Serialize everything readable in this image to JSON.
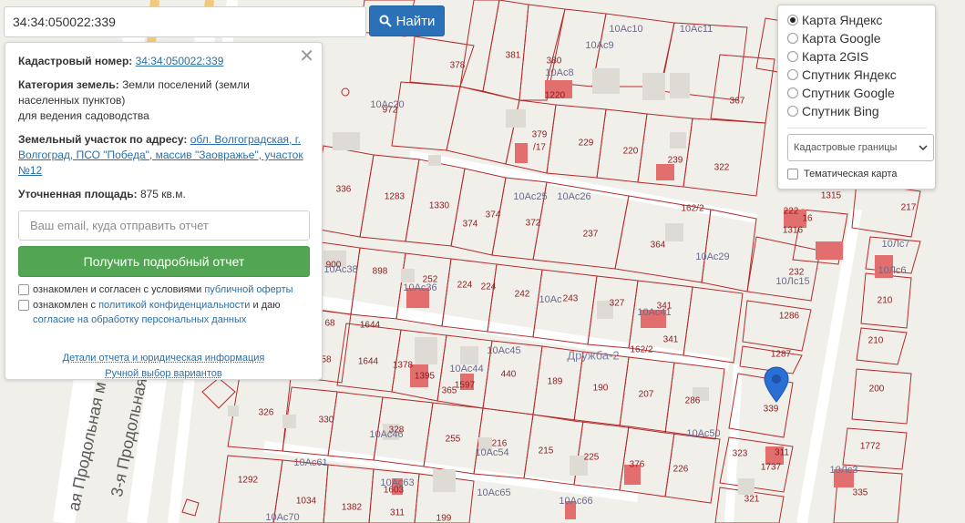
{
  "search": {
    "value": "34:34:050022:339",
    "button_label": "Найти",
    "button_icon": "search-icon"
  },
  "info_card": {
    "cadastral_label": "Кадастровый номер:",
    "cadastral_value": "34:34:050022:339",
    "category_label": "Категория земель:",
    "category_value": "Земли поселений (земли населенных пунктов)",
    "usage_value": "для ведения садоводства",
    "address_label": "Земельный участок по адресу:",
    "address_value": "обл. Волгоградская, г. Волгоград, ПСО \"Победа\", массив \"Заовражье\", участок №12",
    "area_label": "Уточненная площадь:",
    "area_value": "875 кв.м.",
    "email_placeholder": "Ваш email, куда отправить отчет",
    "report_button": "Получить подробный отчет",
    "agree1_text": "ознакомлен и согласен с условиями",
    "agree1_link": "публичной оферты",
    "agree2_text": "ознакомлен с",
    "agree2_link": "политикой конфиденциальности",
    "agree2_and": "и даю",
    "agree2_link2": "согласие на обработку персональных данных",
    "details_link": "Детали отчета и юридическая информация",
    "manual_link": "Ручной выбор вариантов",
    "close_icon": "close-icon"
  },
  "layer_panel": {
    "options": [
      {
        "label": "Карта Яндекс",
        "checked": true
      },
      {
        "label": "Карта Google",
        "checked": false
      },
      {
        "label": "Карта 2GIS",
        "checked": false
      },
      {
        "label": "Спутник Яндекс",
        "checked": false
      },
      {
        "label": "Спутник Google",
        "checked": false
      },
      {
        "label": "Спутник Bing",
        "checked": false
      }
    ],
    "select_value": "Кадастровые границы",
    "thematic_label": "Тематическая карта"
  },
  "map": {
    "street_label_1": "3-я Продольная",
    "street_label_2": "ая Продольная м",
    "drujba_label": "Дружба-2",
    "selected_plot": "339",
    "pin_icon": "map-pin-icon",
    "plot_labels": [
      "378",
      "381",
      "380",
      "10Ac8",
      "10Ac9",
      "10Ac10",
      "10Ac11",
      "1220",
      "972",
      "10Ac20",
      "379",
      "/17",
      "229",
      "220",
      "239",
      "322",
      "367",
      "336",
      "1283",
      "1330",
      "374",
      "374",
      "10Ac25",
      "10Ac26",
      "372",
      "237",
      "364",
      "162/2",
      "10Ac29",
      "900",
      "10Ac38",
      "898",
      "252",
      "10Ac36",
      "224",
      "224",
      "242",
      "10Ac",
      "243",
      "327",
      "341",
      "10Ac41",
      "341",
      "1644",
      "1378",
      "1395",
      "10Ac44",
      "10Ac45",
      "1597",
      "365",
      "440",
      "189",
      "190",
      "207",
      "286",
      "162/2",
      "1644",
      "326",
      "330",
      "328",
      "10Ac46",
      "255",
      "216",
      "10Ac54",
      "215",
      "225",
      "376",
      "10Ac50",
      "226",
      "323",
      "311",
      "1737",
      "339",
      "1292",
      "10Ac61",
      "1034",
      "1382",
      "10Ac63",
      "1603",
      "10Ac65",
      "311",
      "199",
      "10Ac66",
      "10Ac70",
      "321",
      "1287",
      "1286",
      "232",
      "10Лс15",
      "222",
      "16",
      "1316",
      "1315",
      "217",
      "10Лс7",
      "10Лс6",
      "210",
      "210",
      "200",
      "1772",
      "10Лс3",
      "335",
      "68",
      "58"
    ]
  }
}
